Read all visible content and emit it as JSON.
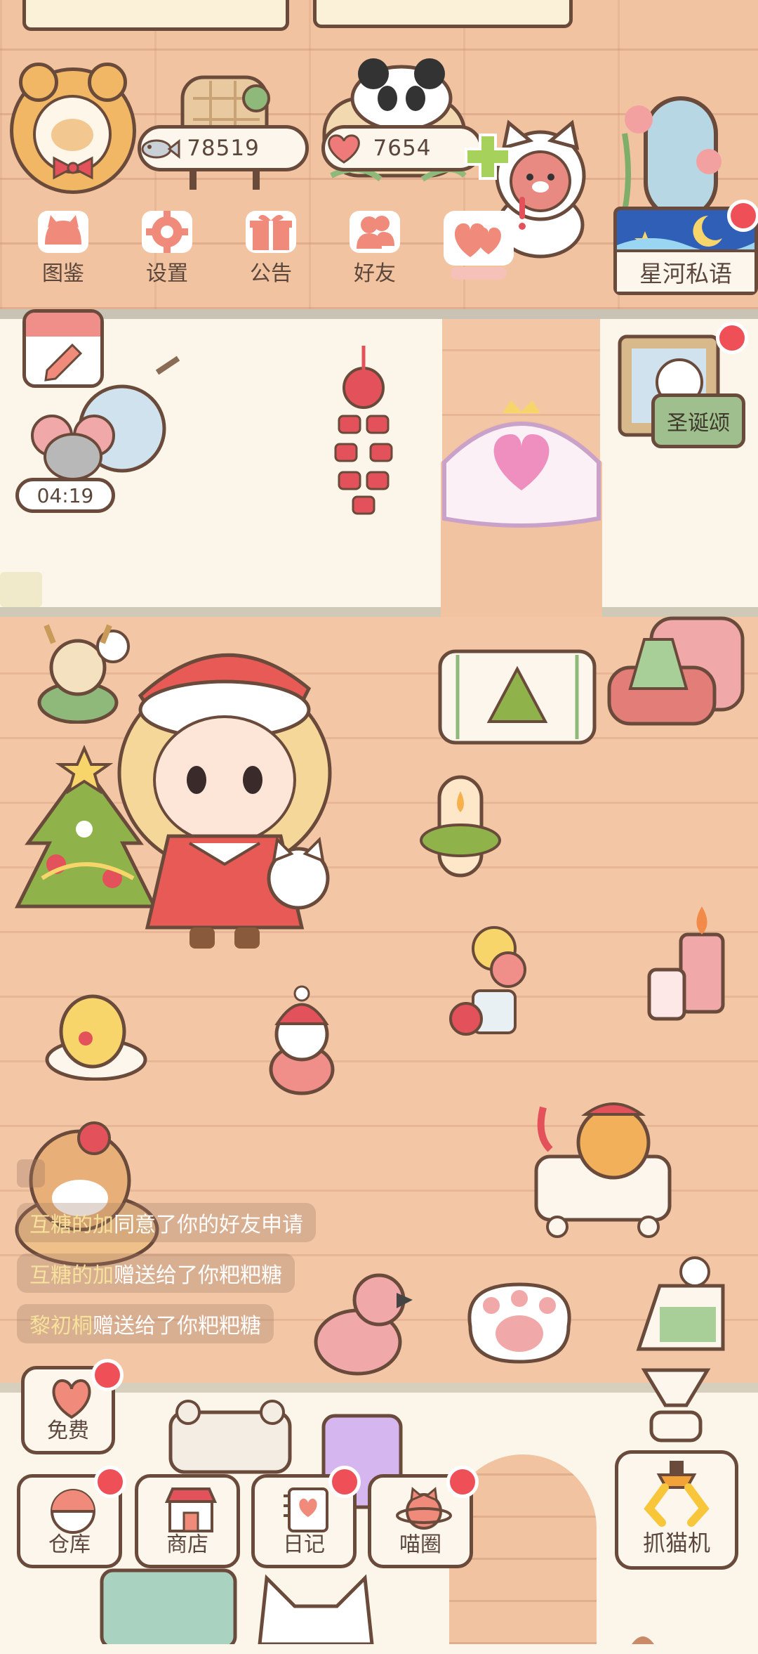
{
  "hud": {
    "coins": "78519",
    "hearts": "7654"
  },
  "menu": [
    {
      "label": "图鉴"
    },
    {
      "label": "设置"
    },
    {
      "label": "公告"
    },
    {
      "label": "好友"
    }
  ],
  "xinghe": {
    "label": "星河私语"
  },
  "event": {
    "label": "圣诞颂"
  },
  "timer": {
    "value": "04:19"
  },
  "chat": [
    {
      "who": "互糖的加",
      "text": "同意了你的好友申请"
    },
    {
      "who": "互糖的加",
      "text": "赠送给了你粑粑糖"
    },
    {
      "who": "黎初桐",
      "text": "赠送给了你粑粑糖"
    }
  ],
  "nav": {
    "free": "免费",
    "warehouse": "仓库",
    "shop": "商店",
    "diary": "日记",
    "circle": "喵圈",
    "claw": "抓猫机"
  },
  "colors": {
    "accent_red": "#ef5058",
    "outline": "#6a4a3a",
    "wall": "#f1c3a0",
    "panel": "#fdf6ec"
  }
}
